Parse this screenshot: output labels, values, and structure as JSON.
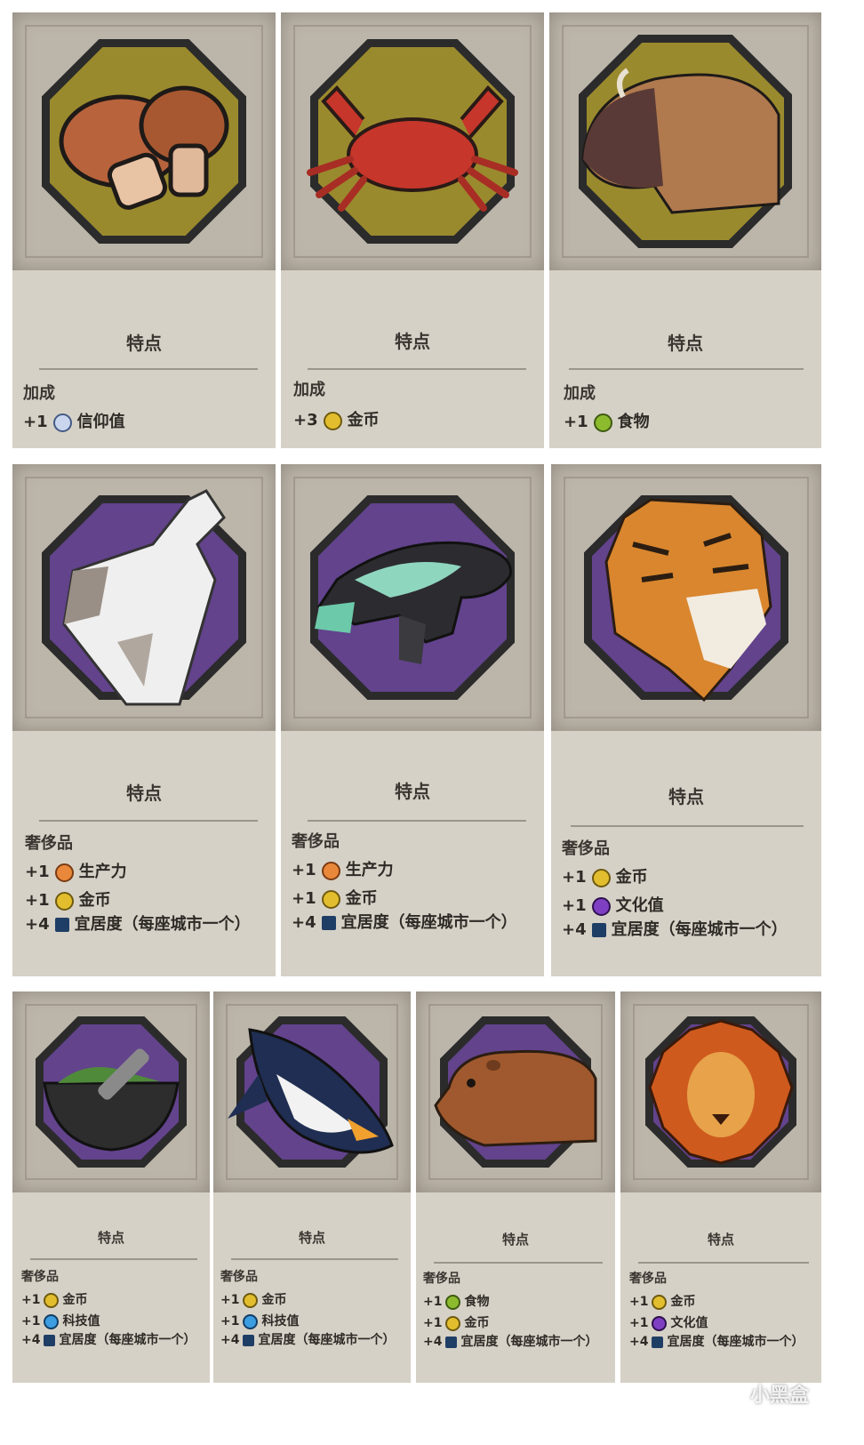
{
  "colors": {
    "gold_bg": "#9a8a2e",
    "purple_bg": "#62438c",
    "card_bg": "#d6d1c6",
    "text": "#2e2a26"
  },
  "cards": [
    {
      "name": "mushroom",
      "icon": "mushroom-icon",
      "bg": "gold",
      "title": "特点",
      "category": "加成",
      "lines": [
        {
          "amount": "+1",
          "yield_icon": "faith-icon",
          "yield": "信仰值"
        }
      ]
    },
    {
      "name": "crab",
      "icon": "crab-icon",
      "bg": "gold",
      "title": "特点",
      "category": "加成",
      "lines": [
        {
          "amount": "+3",
          "yield_icon": "gold-icon",
          "yield": "金币"
        }
      ]
    },
    {
      "name": "bison",
      "icon": "bison-icon",
      "bg": "gold",
      "title": "特点",
      "category": "加成",
      "lines": [
        {
          "amount": "+1",
          "yield_icon": "food-icon",
          "yield": "食物"
        }
      ]
    },
    {
      "name": "wolf",
      "icon": "wolf-icon",
      "bg": "purple",
      "title": "特点",
      "category": "奢侈品",
      "lines": [
        {
          "amount": "+1",
          "yield_icon": "production-icon",
          "yield": "生产力"
        },
        {
          "amount": "+1",
          "yield_icon": "gold-icon",
          "yield": "金币"
        },
        {
          "amount": "+4",
          "yield_icon": "amenity-icon",
          "yield": "宜居度（每座城市一个）"
        }
      ]
    },
    {
      "name": "frog",
      "icon": "frog-icon",
      "bg": "purple",
      "title": "特点",
      "category": "奢侈品",
      "lines": [
        {
          "amount": "+1",
          "yield_icon": "production-icon",
          "yield": "生产力"
        },
        {
          "amount": "+1",
          "yield_icon": "gold-icon",
          "yield": "金币"
        },
        {
          "amount": "+4",
          "yield_icon": "amenity-icon",
          "yield": "宜居度（每座城市一个）"
        }
      ]
    },
    {
      "name": "tiger",
      "icon": "tiger-icon",
      "bg": "purple",
      "title": "特点",
      "category": "奢侈品",
      "lines": [
        {
          "amount": "+1",
          "yield_icon": "gold-icon",
          "yield": "金币"
        },
        {
          "amount": "+1",
          "yield_icon": "culture-icon",
          "yield": "文化值"
        },
        {
          "amount": "+4",
          "yield_icon": "amenity-icon",
          "yield": "宜居度（每座城市一个）"
        }
      ]
    },
    {
      "name": "mortar",
      "icon": "mortar-pestle-icon",
      "bg": "purple",
      "title": "特点",
      "category": "奢侈品",
      "lines": [
        {
          "amount": "+1",
          "yield_icon": "gold-icon",
          "yield": "金币"
        },
        {
          "amount": "+1",
          "yield_icon": "science-icon",
          "yield": "科技值"
        },
        {
          "amount": "+4",
          "yield_icon": "amenity-icon",
          "yield": "宜居度（每座城市一个）"
        }
      ]
    },
    {
      "name": "penguin",
      "icon": "penguin-icon",
      "bg": "purple",
      "title": "特点",
      "category": "奢侈品",
      "lines": [
        {
          "amount": "+1",
          "yield_icon": "gold-icon",
          "yield": "金币"
        },
        {
          "amount": "+1",
          "yield_icon": "science-icon",
          "yield": "科技值"
        },
        {
          "amount": "+4",
          "yield_icon": "amenity-icon",
          "yield": "宜居度（每座城市一个）"
        }
      ]
    },
    {
      "name": "capybara",
      "icon": "capybara-icon",
      "bg": "purple",
      "title": "特点",
      "category": "奢侈品",
      "lines": [
        {
          "amount": "+1",
          "yield_icon": "food-icon",
          "yield": "食物"
        },
        {
          "amount": "+1",
          "yield_icon": "gold-icon",
          "yield": "金币"
        },
        {
          "amount": "+4",
          "yield_icon": "amenity-icon",
          "yield": "宜居度（每座城市一个）"
        }
      ]
    },
    {
      "name": "lion",
      "icon": "lion-icon",
      "bg": "purple",
      "title": "特点",
      "category": "奢侈品",
      "lines": [
        {
          "amount": "+1",
          "yield_icon": "gold-icon",
          "yield": "金币"
        },
        {
          "amount": "+1",
          "yield_icon": "culture-icon",
          "yield": "文化值"
        },
        {
          "amount": "+4",
          "yield_icon": "amenity-icon",
          "yield": "宜居度（每座城市一个）"
        }
      ]
    }
  ],
  "watermark": "小黑盒"
}
